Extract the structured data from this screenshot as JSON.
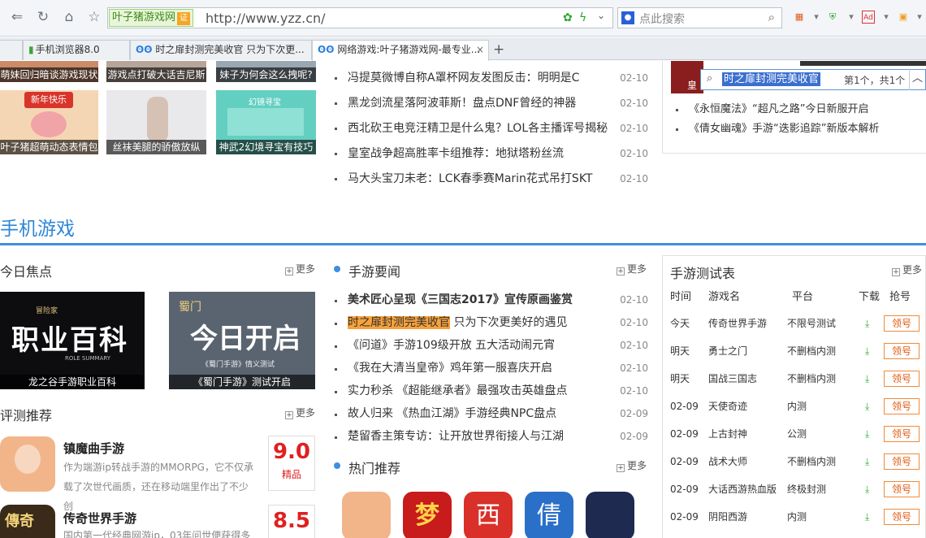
{
  "browser": {
    "site_badge": "叶子猪游戏网",
    "cert_label": "证",
    "url": "http://www.yzz.cn/",
    "search_placeholder": "点此搜索",
    "tabs": [
      {
        "label": "手机浏览器8.0"
      },
      {
        "label": "时之扉封测完美收官 只为下次更..."
      },
      {
        "label": "网络游戏:叶子猪游戏网-最专业..."
      }
    ]
  },
  "find_bar": {
    "query": "时之扉封测完美收官",
    "count": "第1个，共1个"
  },
  "top_thumbs": [
    {
      "caption": "萌妹回归暗谈游戏现状"
    },
    {
      "caption": "游戏点打破大话吉尼斯"
    },
    {
      "caption": "妹子为何会这么拽呢?"
    },
    {
      "caption": "叶子猪超萌动态表情包",
      "banner": "新年快乐"
    },
    {
      "caption": "丝袜美腿的骄傲放纵"
    },
    {
      "caption": "神武2幻境寻宝有技巧",
      "text": "幻镜寻宝"
    }
  ],
  "top_news": [
    {
      "title": "冯提莫微博自称A罩杯网友发图反击：明明是C",
      "date": "02-10"
    },
    {
      "title": "黑龙剑流星落阿波菲斯！盘点DNF曾经的神器",
      "date": "02-10"
    },
    {
      "title": "西北砍王电竞汪精卫是什么鬼？LOL各主播诨号揭秘",
      "date": "02-10"
    },
    {
      "title": "皇室战争超高胜率卡组推荐：地狱塔粉丝流",
      "date": "02-10"
    },
    {
      "title": "马大头宝刀未老：LCK春季赛Marin花式吊打SKT",
      "date": "02-10"
    }
  ],
  "side_news": [
    {
      "title": "《永恒魔法》“超凡之路”今日新服开启"
    },
    {
      "title": "《倩女幽魂》手游“迭影追踪”新版本解析"
    }
  ],
  "side_banner_char": "皇",
  "section_title": "手机游戏",
  "more_label": "更多",
  "focus": {
    "title": "今日焦点",
    "items": [
      {
        "caption": "龙之谷手游职业百科",
        "art": "职业百科",
        "art_top": "冒险家",
        "art_sub": "ROLE SUMMARY"
      },
      {
        "caption": "《蜀门手游》测试开启",
        "art": "今日开启",
        "art_top": "蜀门",
        "art_sub": "《蜀门手游》情义测试"
      }
    ]
  },
  "mobile_news": {
    "title": "手游要闻",
    "items": [
      {
        "title": "美术匠心呈现《三国志2017》宣传原画鉴赏",
        "date": "02-10",
        "bold": true
      },
      {
        "title": "时之扉封测完美收官",
        "suffix": " 只为下次更美好的遇见",
        "date": "02-10",
        "highlight": true
      },
      {
        "title": "《问道》手游109级开放 五大活动闹元宵",
        "date": "02-10"
      },
      {
        "title": "《我在大清当皇帝》鸡年第一服喜庆开启",
        "date": "02-10"
      },
      {
        "title": "实力秒杀 《超能继承者》最强攻击英雄盘点",
        "date": "02-10"
      },
      {
        "title": "故人归来 《热血江湖》手游经典NPC盘点",
        "date": "02-09"
      },
      {
        "title": "楚留香主策专访：让开放世界衔接人与江湖",
        "date": "02-09"
      }
    ]
  },
  "reviews": {
    "title": "评测推荐",
    "items": [
      {
        "name": "镇魔曲手游",
        "desc": "作为端游ip转战手游的MMORPG，它不仅承载了次世代画质，还在移动端里作出了不少创",
        "score": "9.0",
        "tag": "精品"
      },
      {
        "name": "传奇世界手游",
        "desc": "国内第一代经典网游ip，03年问世便获得多",
        "score": "8.5",
        "icon_text": "傳奇"
      }
    ]
  },
  "hot": {
    "title": "热门推荐",
    "icon_chars": [
      "",
      "梦",
      "西",
      "倩",
      ""
    ]
  },
  "test_table": {
    "title": "手游测试表",
    "headers": [
      "时间",
      "游戏名",
      "平台",
      "下载",
      "抢号"
    ],
    "rows": [
      {
        "time": "今天",
        "name": "传奇世界手游",
        "platform": "不限号测试",
        "btn": "领号"
      },
      {
        "time": "明天",
        "name": "勇士之门",
        "platform": "不删档内测",
        "btn": "领号"
      },
      {
        "time": "明天",
        "name": "国战三国志",
        "platform": "不删档内测",
        "btn": "领号"
      },
      {
        "time": "02-09",
        "name": "天使奇迹",
        "platform": "内测",
        "btn": "领号"
      },
      {
        "time": "02-09",
        "name": "上古封神",
        "platform": "公测",
        "btn": "领号"
      },
      {
        "time": "02-09",
        "name": "战术大师",
        "platform": "不删档内测",
        "btn": "领号"
      },
      {
        "time": "02-09",
        "name": "大话西游热血版",
        "platform": "终极封测",
        "btn": "领号"
      },
      {
        "time": "02-09",
        "name": "阴阳西游",
        "platform": "内测",
        "btn": "领号"
      }
    ]
  },
  "colors": {
    "accent": "#2e86d8",
    "find_highlight": "#f7a23c",
    "score": "#e02020",
    "download": "#3bb03b"
  }
}
